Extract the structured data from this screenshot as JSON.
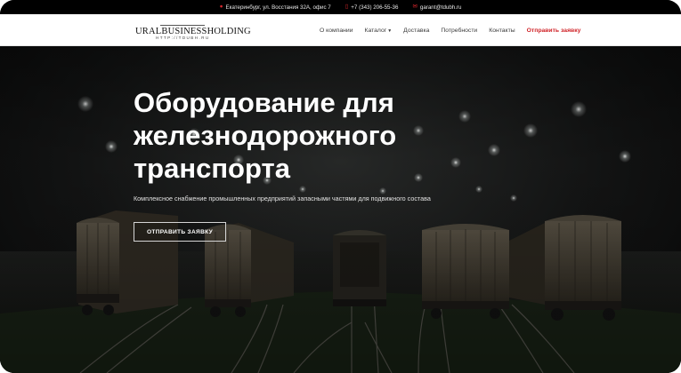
{
  "topbar": {
    "address": "Екатеринбург, ул. Восстания 32А, офис 7",
    "phone": "+7 (343) 206-55-36",
    "email": "garant@tdubh.ru",
    "address_icon": "map-pin-icon",
    "phone_icon": "phone-icon",
    "email_icon": "envelope-icon"
  },
  "logo": {
    "name": "URALBUSINESSHOLDING",
    "url": "HTTP://TDUBH.RU"
  },
  "nav": {
    "items": [
      {
        "label": "О компании"
      },
      {
        "label": "Каталог",
        "has_dropdown": true
      },
      {
        "label": "Доставка"
      },
      {
        "label": "Потребности"
      },
      {
        "label": "Контакты"
      }
    ],
    "cta_label": "Отправить заявку",
    "cta_color": "#d02328"
  },
  "hero": {
    "title_lines": [
      "Оборудование для",
      "железнодорожного",
      "транспорта"
    ],
    "subtitle": "Комплексное снабжение промышленных предприятий запасными частями для подвижного состава",
    "button_label": "ОТПРАВИТЬ ЗАЯВКУ"
  }
}
